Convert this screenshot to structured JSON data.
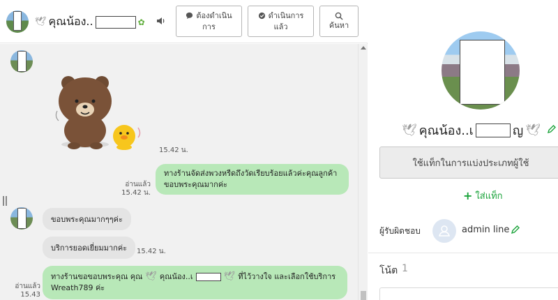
{
  "header": {
    "contact_name": "คุณน้อง..",
    "btn_todo": {
      "line1": "ต้องดำเนิน",
      "line2": "การ"
    },
    "btn_done": {
      "line1": "ดำเนินการ",
      "line2": "แล้ว"
    },
    "btn_search": {
      "label": "ค้นหา"
    }
  },
  "messages": {
    "sticker_time": "15.42 น.",
    "out1": {
      "read": "อ่านแล้ว",
      "time": "15.42 น.",
      "text": "ทางร้านจัดส่งพวงหรีดถึงวัดเรียบร้อยแล้วค่ะคุณลูกค้า ขอบพระคุณมากค่ะ"
    },
    "in1": {
      "text": "ขอบพระคุณมากๆๆค่ะ"
    },
    "in2": {
      "text": "บริการยอดเยี่ยมมากค่ะ",
      "time": "15.42 น."
    },
    "out2": {
      "read": "อ่านแล้ว",
      "time": "15.43 น.",
      "text_a": "ทางร้านขอขอบพระคุณ   คุณ",
      "text_b": "คุณน้อง..เ",
      "text_c": "ที่ไว้วางใจ และเลือกใช้บริการ",
      "text_d": "Wreath789 ค่ะ"
    }
  },
  "profile": {
    "name": "คุณน้อง..เ",
    "name_tail": "ญ",
    "tag_button": "ใช้แท็กในการแบ่งประเภทผู้ใช้",
    "add_tag": "ใส่แท็ก",
    "assignee_label": "ผู้รับผิดชอบ",
    "assignee_name": "admin line",
    "note_label": "โน้ต",
    "note_count": "1"
  },
  "colors": {
    "accent_green": "#1aa33a",
    "bubble_out": "#b8e8b8",
    "bubble_in": "#e4e4e4"
  }
}
